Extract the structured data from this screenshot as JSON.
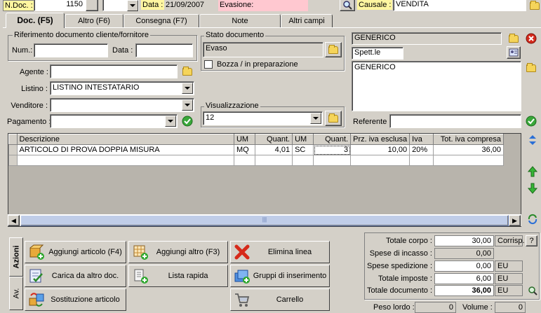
{
  "header": {
    "ndoc_label": "N.Doc. :",
    "ndoc_value": "1150",
    "data_label": "Data :",
    "data_value": "21/09/2007",
    "evasione_label": "Evasione:",
    "evasione_value": "",
    "causale_label": "Causale :",
    "causale_value": "VENDITA"
  },
  "tabs": [
    "Doc. (F5)",
    "Altro (F6)",
    "Consegna (F7)",
    "Note",
    "Altri campi"
  ],
  "riferimento": {
    "legend": "Riferimento documento cliente/fornitore",
    "num_label": "Num.:",
    "num_value": "",
    "data_label": "Data :",
    "data_value": ""
  },
  "stato": {
    "legend": "Stato documento",
    "value": "Evaso",
    "bozza_label": "Bozza / in preparazione",
    "bozza_checked": false
  },
  "fields": {
    "agente_label": "Agente :",
    "agente_value": "",
    "listino_label": "Listino :",
    "listino_value": "LISTINO INTESTATARIO",
    "venditore_label": "Venditore :",
    "venditore_value": "",
    "pagamento_label": "Pagamento :",
    "pagamento_value": ""
  },
  "visualizzazione": {
    "legend": "Visualizzazione",
    "value": "12"
  },
  "cliente": {
    "name": "GENERICO",
    "title": "Spett.le",
    "address": "GENERICO",
    "referente_label": "Referente",
    "referente_value": ""
  },
  "grid": {
    "headers": [
      "Descrizione",
      "UM",
      "Quant.",
      "UM",
      "Quant.",
      "Prz. iva esclusa",
      "Iva",
      "Tot. iva compresa"
    ],
    "rows": [
      [
        "ARTICOLO DI PROVA DOPPIA MISURA",
        "MQ",
        "4,01",
        "SC",
        "3",
        "10,00",
        "20%",
        "36,00"
      ]
    ]
  },
  "side_tabs": [
    "Azioni",
    "Av."
  ],
  "actions": [
    {
      "label": "Aggiungi articolo (F4)",
      "icon": "box-add-icon"
    },
    {
      "label": "Aggiungi altro (F3)",
      "icon": "grid-add-icon"
    },
    {
      "label": "Elimina linea",
      "icon": "red-x-icon"
    },
    {
      "label": "Carica da altro doc.",
      "icon": "doc-load-icon"
    },
    {
      "label": "Lista rapida",
      "icon": "list-add-icon"
    },
    {
      "label": "Gruppi di inserimento",
      "icon": "group-insert-icon"
    },
    {
      "label": "Sostituzione articolo",
      "icon": "swap-icon"
    },
    {
      "label": "Carrello",
      "icon": "cart-icon"
    }
  ],
  "totals": {
    "corpo_label": "Totale corpo :",
    "corpo_value": "30,00",
    "corpo_unit": "Corrisp.",
    "incasso_label": "Spese di incasso :",
    "incasso_value": "0,00",
    "spedizione_label": "Spese spedizione :",
    "spedizione_value": "0,00",
    "spedizione_unit": "EU",
    "imposte_label": "Totale imposte :",
    "imposte_value": "6,00",
    "imposte_unit": "EU",
    "documento_label": "Totale documento :",
    "documento_value": "36,00",
    "documento_unit": "EU",
    "peso_label": "Peso lordo :",
    "peso_value": "0",
    "volume_label": "Volume :",
    "volume_value": "0",
    "help": "?"
  }
}
